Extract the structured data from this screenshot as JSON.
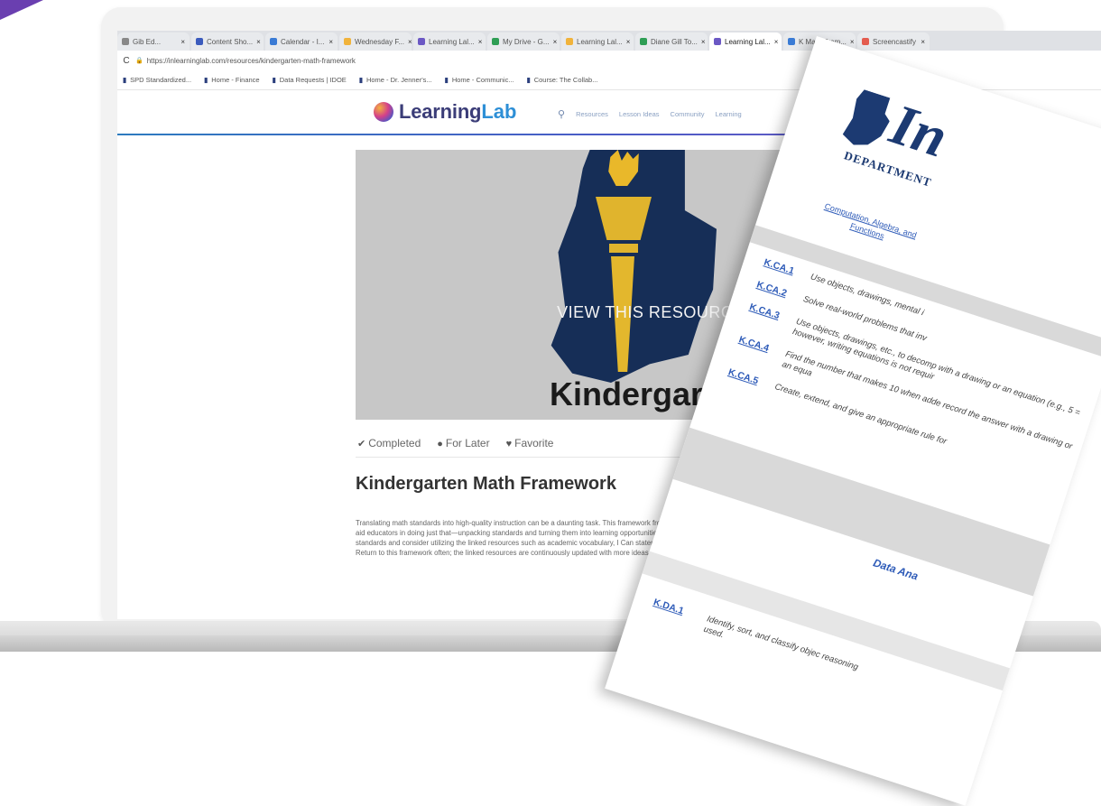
{
  "browser": {
    "tabs": [
      {
        "label": "Gib Ed...",
        "color": "#888888",
        "active": false
      },
      {
        "label": "Content Sho...",
        "color": "#3b5bbd",
        "active": false
      },
      {
        "label": "Calendar - I...",
        "color": "#3a7bd5",
        "active": false
      },
      {
        "label": "Wednesday F...",
        "color": "#f1b33b",
        "active": false
      },
      {
        "label": "Learning Lal...",
        "color": "#6b58c4",
        "active": false
      },
      {
        "label": "My Drive - G...",
        "color": "#2f9e55",
        "active": false
      },
      {
        "label": "Learning Lal...",
        "color": "#f1b33b",
        "active": false
      },
      {
        "label": "Diane Gill To...",
        "color": "#2f9e55",
        "active": false
      },
      {
        "label": "Learning Lal...",
        "color": "#6b58c4",
        "active": true
      },
      {
        "label": "K Math Fram...",
        "color": "#3a7bd5",
        "active": false
      },
      {
        "label": "Screencastify",
        "color": "#e45c4f",
        "active": false
      }
    ],
    "url": "https://inlearninglab.com/resources/kindergarten-math-framework",
    "bookmarks": [
      "SPD Standardized...",
      "Home - Finance",
      "Data Requests | IDOE",
      "Home - Dr. Jenner's...",
      "Home - Communic...",
      "Course: The Collab..."
    ]
  },
  "site": {
    "logo_part1": "Learning",
    "logo_part2": "Lab",
    "nav": [
      "Resources",
      "Lesson Ideas",
      "Community",
      "Learning"
    ]
  },
  "resource": {
    "view_label": "VIEW THIS RESOURCE",
    "hero_title": "Kindergarten",
    "actions": {
      "completed": "Completed",
      "later": "For Later",
      "favorite": "Favorite"
    },
    "title": "Kindergarten Math Framework",
    "description": [
      "Translating math standards into high-quality instruction can be a daunting task. This framework from the Indiana Depa",
      "aid educators in doing just that—unpacking standards and turning them into learning opportunities for students. Use t",
      "standards and consider utilizing the linked resources such as academic vocabulary, I Can statements, consideratio",
      "Return to this framework often; the linked resources are continuously updated with more ideas for math educators"
    ]
  },
  "document": {
    "logo_text": "In",
    "dept_text": "DEPARTMENT",
    "category_link": "Computation, Algebra, and Functions",
    "standards": [
      {
        "code": "K.CA.1",
        "text": "Use objects, drawings, mental i"
      },
      {
        "code": "K.CA.2",
        "text": "Solve real-world problems that inv"
      },
      {
        "code": "K.CA.3",
        "text": "Use objects, drawings, etc., to decomp with a drawing or an equation (e.g., 5 = however, writing equations is not requir"
      },
      {
        "code": "K.CA.4",
        "text": "Find the number that makes 10 when adde record the answer with a drawing or an equa"
      },
      {
        "code": "K.CA.5",
        "text": "Create, extend, and give an appropriate rule for"
      }
    ],
    "data_heading": "Data Ana",
    "kda": {
      "code": "K.DA.1",
      "text": "Identify, sort, and classify objec reasoning used."
    }
  }
}
